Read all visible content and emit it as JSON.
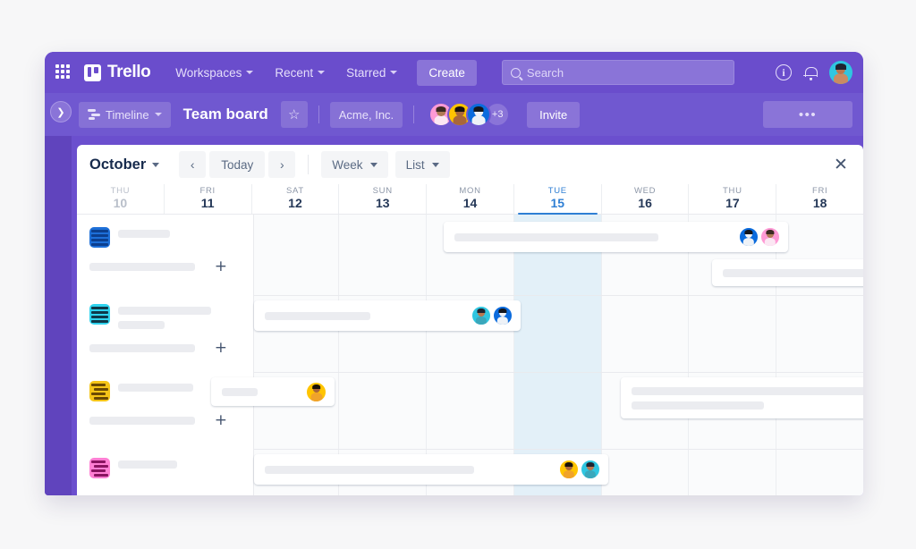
{
  "top_nav": {
    "apps_icon": "grid-apps-icon",
    "brand": "Trello",
    "items": [
      {
        "label": "Workspaces",
        "has_caret": true
      },
      {
        "label": "Recent",
        "has_caret": true
      },
      {
        "label": "Starred",
        "has_caret": true
      }
    ],
    "create_label": "Create",
    "search": {
      "placeholder": "Search",
      "icon": "search-icon",
      "value": ""
    },
    "info_label": "i",
    "icons": [
      "info-icon",
      "bell-icon",
      "user-avatar"
    ]
  },
  "board_bar": {
    "view_chip": {
      "label": "Timeline",
      "icon": "timeline-icon",
      "has_caret": true
    },
    "title": "Team board",
    "star_label": "☆",
    "workspace": "Acme, Inc.",
    "members_overflow": "+3",
    "invite_label": "Invite",
    "more_label": "•••",
    "sidebar_toggle": "❯"
  },
  "calendar": {
    "month": "October",
    "prev_label": "‹",
    "today_label": "Today",
    "next_label": "›",
    "range_label": "Week",
    "view_label": "List",
    "close_label": "✕",
    "days": [
      {
        "dow": "THU",
        "num": "10",
        "state": "past"
      },
      {
        "dow": "FRI",
        "num": "11",
        "state": "normal"
      },
      {
        "dow": "SAT",
        "num": "12",
        "state": "normal"
      },
      {
        "dow": "SUN",
        "num": "13",
        "state": "normal"
      },
      {
        "dow": "MON",
        "num": "14",
        "state": "normal"
      },
      {
        "dow": "TUE",
        "num": "15",
        "state": "today"
      },
      {
        "dow": "WED",
        "num": "16",
        "state": "normal"
      },
      {
        "dow": "THU",
        "num": "17",
        "state": "normal"
      },
      {
        "dow": "FRI",
        "num": "18",
        "state": "normal"
      }
    ],
    "today_index": 5,
    "add_label": "+",
    "rows": [
      {
        "icon": "list-icon-blue",
        "color": "#1d6fd8",
        "title_width": 58,
        "sub": false
      },
      {
        "icon": "list-icon-cyan",
        "color": "#2fd3ee",
        "title_width": 104,
        "sub": true
      },
      {
        "icon": "list-icon-yellow",
        "color": "#f5c518",
        "title_width": 84,
        "sub": false
      },
      {
        "icon": "list-icon-pink",
        "color": "#ff7fd4",
        "title_width": 66,
        "sub": false
      }
    ]
  },
  "colors": {
    "brand_purple": "#6a4dcc",
    "board_bar_purple": "#7058d0",
    "sidebar_purple": "#6044bd",
    "today_blue": "#2f7fd4",
    "today_column": "#e3f0f8",
    "placeholder_grey": "#ebecf0",
    "page_bg": "#f7f7f8"
  }
}
